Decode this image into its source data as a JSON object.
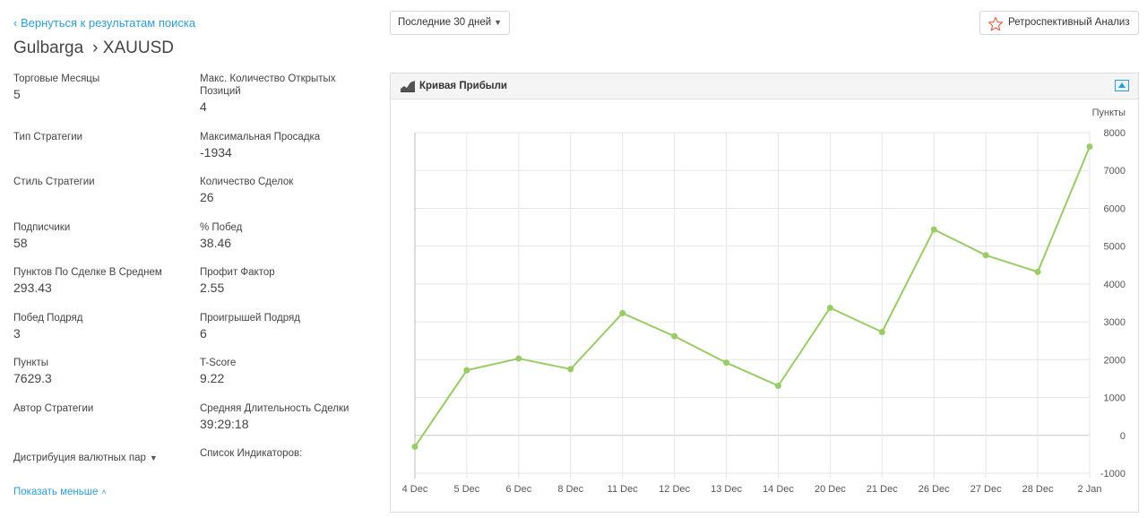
{
  "back_link": "‹ Вернуться к результатам поиска",
  "breadcrumb": {
    "provider": "Gulbarga",
    "symbol": "› XAUUSD"
  },
  "stats_left": [
    {
      "label": "Торговые Месяцы",
      "value": "5"
    },
    {
      "label": "Тип Стратегии",
      "value": ""
    },
    {
      "label": "Стиль Стратегии",
      "value": ""
    },
    {
      "label": "Подписчики",
      "value": "58"
    },
    {
      "label": "Пунктов По Сделке В Среднем",
      "value": "293.43"
    },
    {
      "label": "Побед Подряд",
      "value": "3"
    },
    {
      "label": "Пункты",
      "value": "7629.3"
    },
    {
      "label": "Автор Стратегии",
      "value": ""
    }
  ],
  "stats_right": [
    {
      "label": "Макс. Количество Открытых Позиций",
      "value": "4"
    },
    {
      "label": "Максимальная Просадка",
      "value": "-1934"
    },
    {
      "label": "Количество Сделок",
      "value": "26"
    },
    {
      "label": "% Побед",
      "value": "38.46"
    },
    {
      "label": "Профит Фактор",
      "value": "2.55"
    },
    {
      "label": "Проигрышей Подряд",
      "value": "6"
    },
    {
      "label": "T-Score",
      "value": "9.22"
    },
    {
      "label": "Средняя Длительность Сделки",
      "value": "39:29:18"
    }
  ],
  "currency_distribution": "Дистрибуция валютных пар",
  "indicators_label": "Список Индикаторов:",
  "show_less": "Показать меньше",
  "period_select": {
    "value": "Последние 30 дней"
  },
  "retro_button": "Ретроспективный Анализ",
  "panel_title": "Кривая Прибыли",
  "colors": {
    "link": "#2a9fd6",
    "line": "#99cc66",
    "star": "#e8604c"
  },
  "chart_data": {
    "type": "line",
    "title": "Кривая Прибыли",
    "ylabel": "Пункты",
    "categories": [
      "4 Dec",
      "5 Dec",
      "6 Dec",
      "8 Dec",
      "11 Dec",
      "12 Dec",
      "13 Dec",
      "14 Dec",
      "20 Dec",
      "21 Dec",
      "26 Dec",
      "27 Dec",
      "28 Dec",
      "2 Jan"
    ],
    "values": [
      -300,
      1720,
      2030,
      1750,
      3230,
      2620,
      1920,
      1310,
      3370,
      2730,
      5440,
      4760,
      4320,
      7629
    ],
    "ylim": [
      -1000,
      8000
    ],
    "yticks": [
      8000,
      7000,
      6000,
      5000,
      4000,
      3000,
      2000,
      1000,
      0,
      -1000
    ],
    "grid": true,
    "y_axis_side": "right"
  }
}
